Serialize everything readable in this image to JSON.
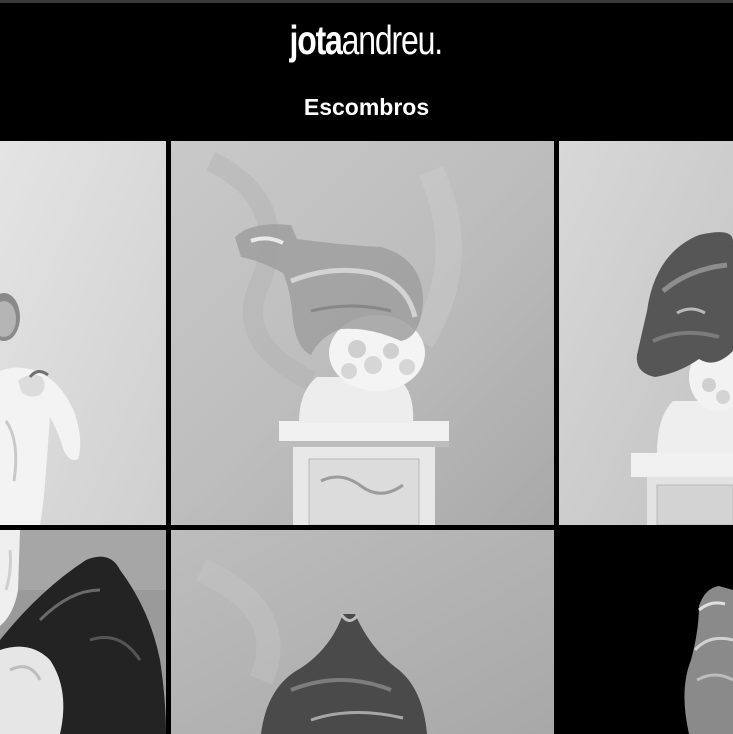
{
  "header": {
    "logo_bold": "jota",
    "logo_light": "andreu",
    "logo_dot": ".",
    "title": "Escombros"
  },
  "gallery": {
    "items": [
      {
        "subject": "white statue figure with hand at chest, grey wall",
        "tone": "light"
      },
      {
        "subject": "plaster bust wrapped in plastic bag on pedestal",
        "tone": "light"
      },
      {
        "subject": "bust with dark plastic over head on pedestal",
        "tone": "light"
      },
      {
        "subject": "statue with black plastic bag",
        "tone": "mid"
      },
      {
        "subject": "bust covered in plastic, grey wall",
        "tone": "light"
      },
      {
        "subject": "plastic-wrapped figure on black background",
        "tone": "dark"
      }
    ]
  }
}
